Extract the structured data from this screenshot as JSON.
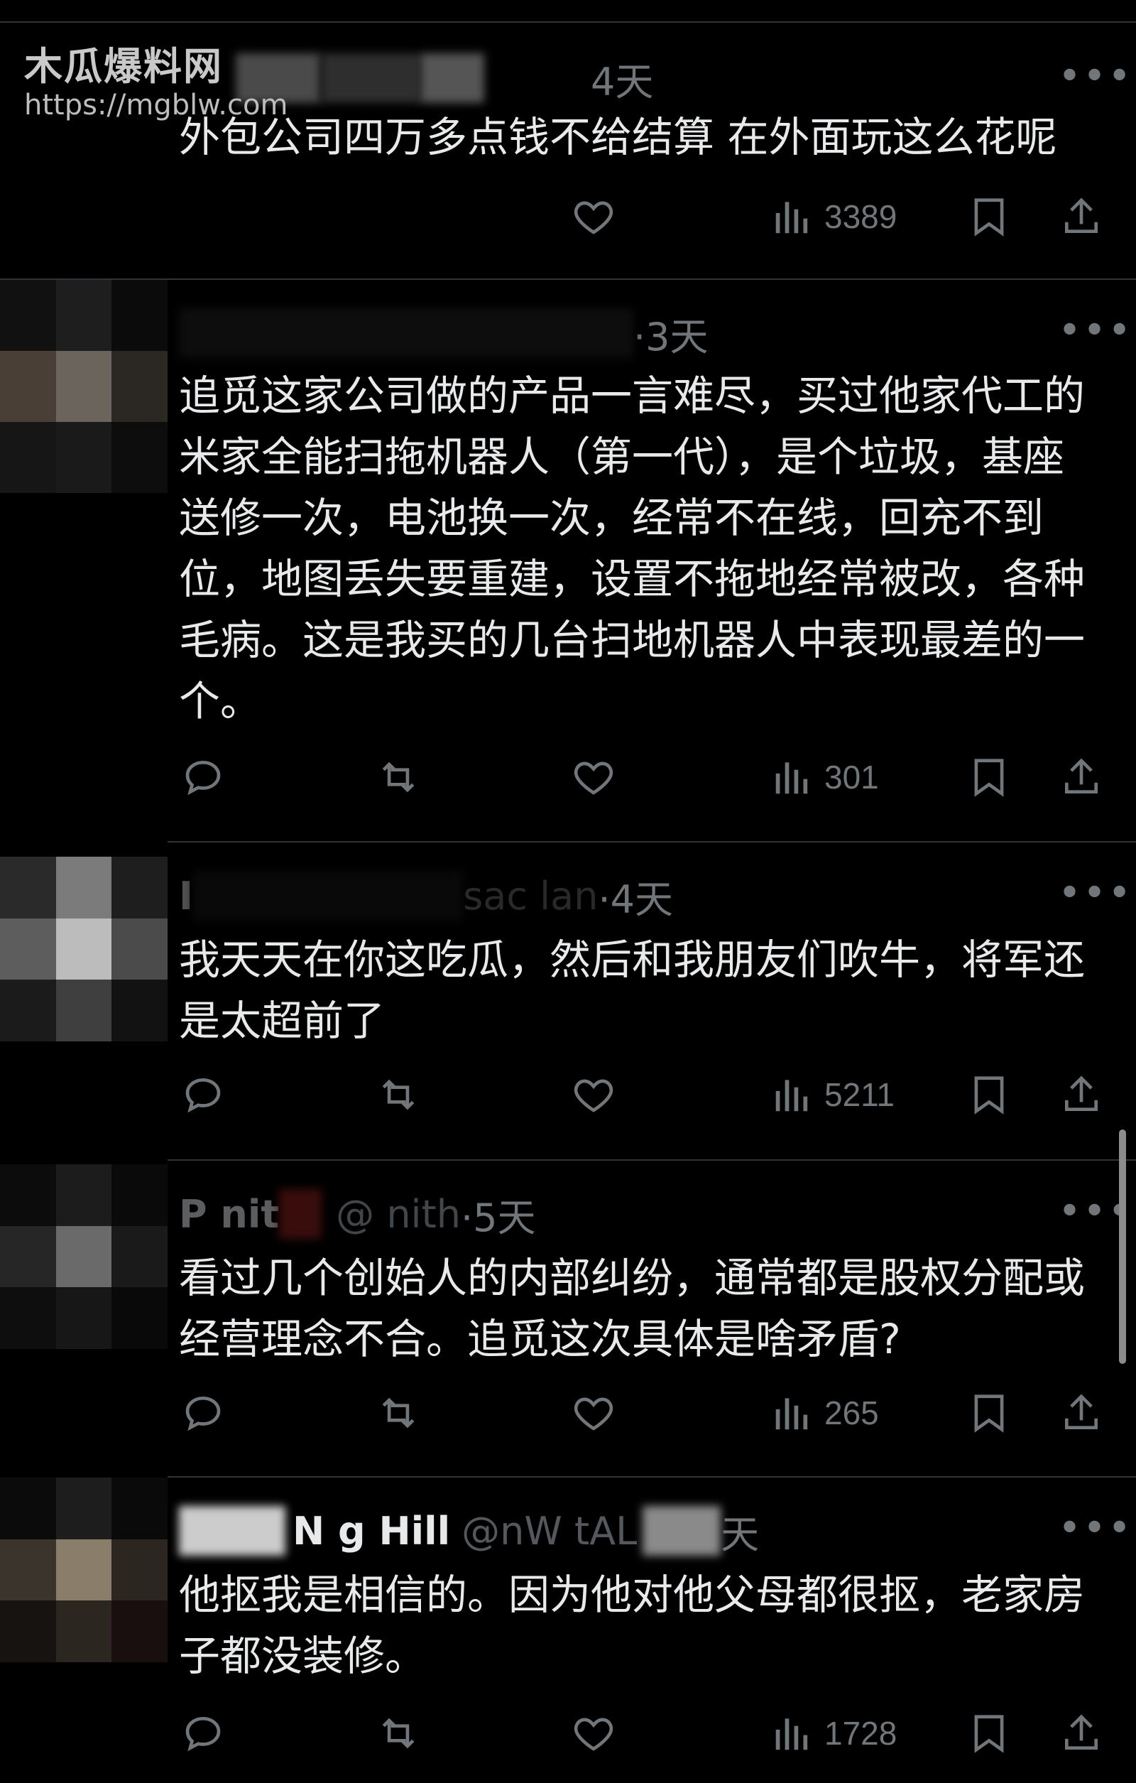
{
  "watermark": {
    "title": "木瓜爆料网",
    "url": "https://mgblw.com"
  },
  "tweets": [
    {
      "name": "",
      "handle": "",
      "time": "4天",
      "content": "外包公司四万多点钱不给结算  在外面玩这么花呢",
      "counts": {
        "reply": "",
        "retweet": "",
        "like": "",
        "views": "3389"
      }
    },
    {
      "name": "",
      "handle": "",
      "time": "·3天",
      "content": "追觅这家公司做的产品一言难尽，买过他家代工的米家全能扫拖机器人（第一代），是个垃圾，基座送修一次，电池换一次，经常不在线，回充不到位，地图丢失要重建，设置不拖地经常被改，各种毛病。这是我买的几台扫地机器人中表现最差的一个。",
      "counts": {
        "reply": "",
        "retweet": "",
        "like": "",
        "views": "301"
      }
    },
    {
      "name": "I",
      "handle": "sac      lan",
      "time": "·4天",
      "content": "我天天在你这吃瓜，然后和我朋友们吹牛，将军还是太超前了",
      "counts": {
        "reply": "",
        "retweet": "",
        "like": "",
        "views": "5211"
      }
    },
    {
      "name": "P      nit",
      "handle": "@      nith",
      "time": "·5天",
      "content": "看过几个创始人的内部纠纷，通常都是股权分配或经营理念不合。追觅这次具体是啥矛盾?",
      "counts": {
        "reply": "",
        "retweet": "",
        "like": "",
        "views": "265"
      }
    },
    {
      "name": "N      g Hill",
      "handle": "@nW       tAL",
      "time": "天",
      "content": "他抠我是相信的。因为他对他父母都很抠，老家房子都没装修。",
      "counts": {
        "reply": "",
        "retweet": "",
        "like": "",
        "views": "1728"
      }
    }
  ],
  "icons": {
    "more": "more-icon",
    "reply": "reply-icon",
    "retweet": "retweet-icon",
    "like": "like-icon",
    "views": "views-icon",
    "bookmark": "bookmark-icon",
    "share": "share-icon"
  },
  "colors": {
    "background": "#000000",
    "text": "#e7e9ea",
    "muted": "#71767b",
    "divider": "#2f3336"
  }
}
